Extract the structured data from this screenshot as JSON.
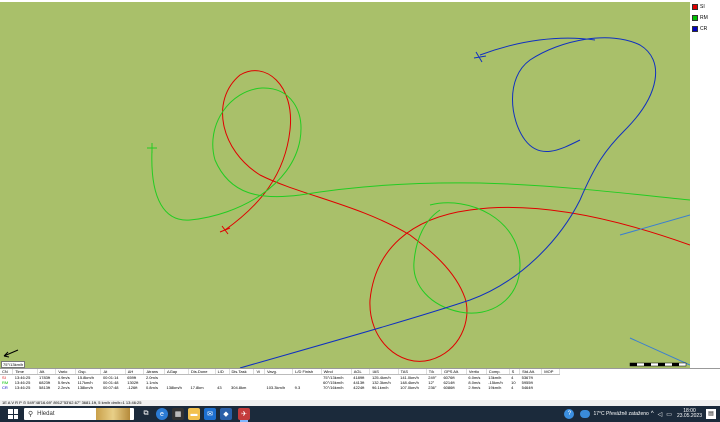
{
  "legend": [
    {
      "label": "SI",
      "color": "#e00000"
    },
    {
      "label": "RM",
      "color": "#00c000"
    },
    {
      "label": "CR",
      "color": "#0000c0"
    }
  ],
  "map": {
    "speed_label": "75°/13km/h",
    "scale_label": "0.5 km"
  },
  "table": {
    "columns": [
      "CN",
      "Time",
      "Alt.",
      "Vario",
      "Gsp.",
      "Δt",
      "ΔH",
      "Δtrans",
      "ΔGap",
      "Dis.Done",
      "L/D",
      "Dis.Task",
      "Vi",
      "Vavg.",
      "L/D Finish",
      "Wind",
      "AGL",
      "IAS",
      "TAS",
      "T/k",
      "GPS Alt.",
      "Vertio",
      "Comp.",
      "S",
      "Std.Alt.",
      "MOP"
    ],
    "rows": [
      {
        "cn": "SI",
        "color": "#e00000",
        "cells": [
          "SI",
          "13:46:25",
          "1783ft",
          "4.9m/s",
          "15.8km/h",
          "00:01:14",
          "659ft",
          "2.0m/s",
          "",
          "",
          "",
          "",
          "",
          "",
          "",
          "75°/13km/h",
          "4189ft",
          "125.4km/h",
          "141.0km/h",
          "249°",
          "6076ft",
          "6.0m/s",
          "13km/h",
          "4",
          "5367ft",
          ""
        ]
      },
      {
        "cn": "RM",
        "color": "#00c000",
        "cells": [
          "RM",
          "13:46:25",
          "6823ft",
          "5.9m/s",
          "117km/h",
          "00:01:48",
          "1302ft",
          "1.1m/s",
          "",
          "",
          "",
          "",
          "",
          "",
          "",
          "60°/15km/h",
          "4413ft",
          "132.3km/h",
          "148.4km/h",
          "12°",
          "6214ft",
          "8.0m/s",
          "-15km/h",
          "10",
          "5955ft",
          ""
        ]
      },
      {
        "cn": "CR",
        "color": "#0000c0",
        "cells": [
          "CR",
          "13:46:25",
          "5813ft",
          "2.2m/s",
          "138km/h",
          "00:07:48",
          "-126ft",
          "0.8m/s",
          "138km/h",
          "17.8km",
          "43",
          "304.8km",
          "",
          "103.3km/h",
          "9.3",
          "70°/16km/h",
          "4224ft",
          "96.1km/h",
          "107.0km/h",
          "236°",
          "6086ft",
          "2.9m/s",
          "19km/h",
          "4",
          "5464ft",
          ""
        ]
      }
    ]
  },
  "status_strip": "1E A V R P  ⊙ 549°48'16.69\" 8912°53'62.67\" 3681.1ft, 5 km/h  dm/h=1 13:46:25",
  "taskbar": {
    "search_placeholder": "Hledat",
    "weather": "17°C  Převážně zataženo",
    "time": "18:00",
    "date": "23.05.2023"
  },
  "colors": {
    "map_bg": "#a9c06a",
    "taskbar_bg": "#1b2a3b"
  }
}
